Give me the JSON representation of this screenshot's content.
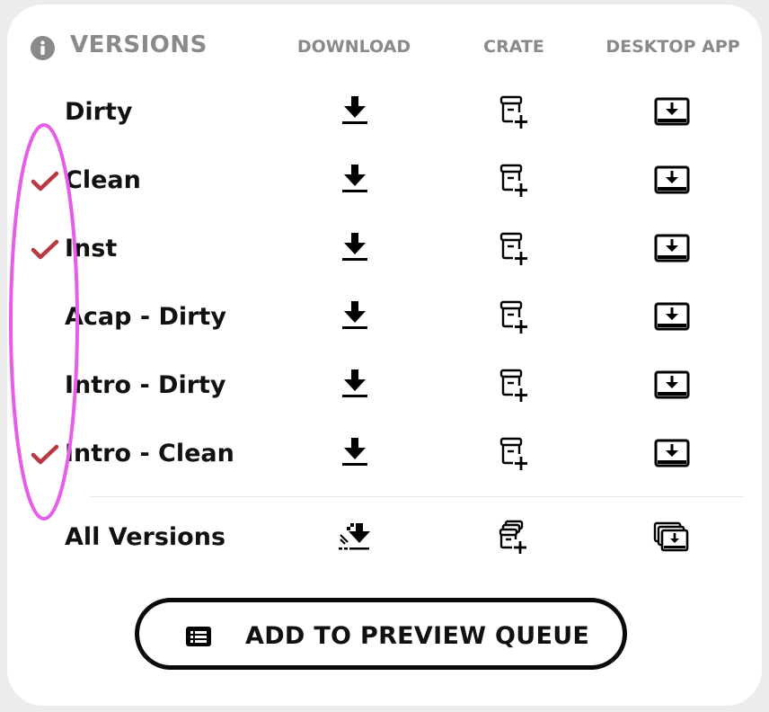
{
  "header": {
    "title": "VERSIONS",
    "columns": {
      "download": "DOWNLOAD",
      "crate": "CRATE",
      "app": "DESKTOP APP"
    }
  },
  "versions": [
    {
      "label": "Dirty",
      "checked": false
    },
    {
      "label": "Clean",
      "checked": true
    },
    {
      "label": "Inst",
      "checked": true
    },
    {
      "label": "Acap - Dirty",
      "checked": false
    },
    {
      "label": "Intro - Dirty",
      "checked": false
    },
    {
      "label": "Intro - Clean",
      "checked": true
    }
  ],
  "all_versions": {
    "label": "All Versions"
  },
  "queue_button": {
    "label": "ADD TO PREVIEW QUEUE"
  },
  "colors": {
    "check": "#b63a3e",
    "annotation": "#e85ce8",
    "header_text": "#8a8a8a",
    "text": "#111111"
  },
  "icons": {
    "info": "info-icon",
    "check": "check-icon",
    "download": "download-icon",
    "crate": "crate-add-icon",
    "app": "desktop-app-icon",
    "download_all": "download-all-icon",
    "crate_all": "crate-add-all-icon",
    "app_all": "desktop-app-all-icon",
    "queue": "list-icon"
  }
}
